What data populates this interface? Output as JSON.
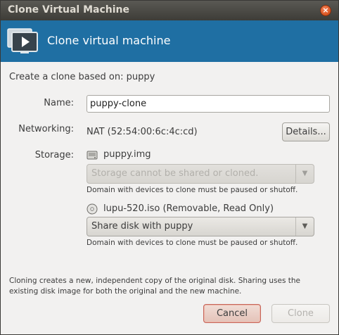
{
  "window": {
    "title": "Clone Virtual Machine"
  },
  "banner": {
    "heading": "Clone virtual machine"
  },
  "subtitle": "Create a clone based on: puppy",
  "name": {
    "label": "Name:",
    "value": "puppy-clone"
  },
  "networking": {
    "label": "Networking:",
    "value": "NAT (52:54:00:6c:4c:cd)",
    "details_button": "Details..."
  },
  "storage": {
    "label": "Storage:",
    "disks": [
      {
        "name": "puppy.img",
        "combo": "Storage cannot be shared or cloned.",
        "hint": "Domain with devices to clone must be paused or shutoff."
      },
      {
        "name": "lupu-520.iso (Removable, Read Only)",
        "combo": "Share disk with puppy",
        "hint": "Domain with devices to clone must be paused or shutoff."
      }
    ]
  },
  "footer_note": "Cloning creates a new, independent copy of the original disk. Sharing uses the existing disk image for both the original and the new machine.",
  "buttons": {
    "cancel": "Cancel",
    "clone": "Clone"
  },
  "colors": {
    "banner": "#1f6fa3",
    "close": "#d9531e"
  }
}
